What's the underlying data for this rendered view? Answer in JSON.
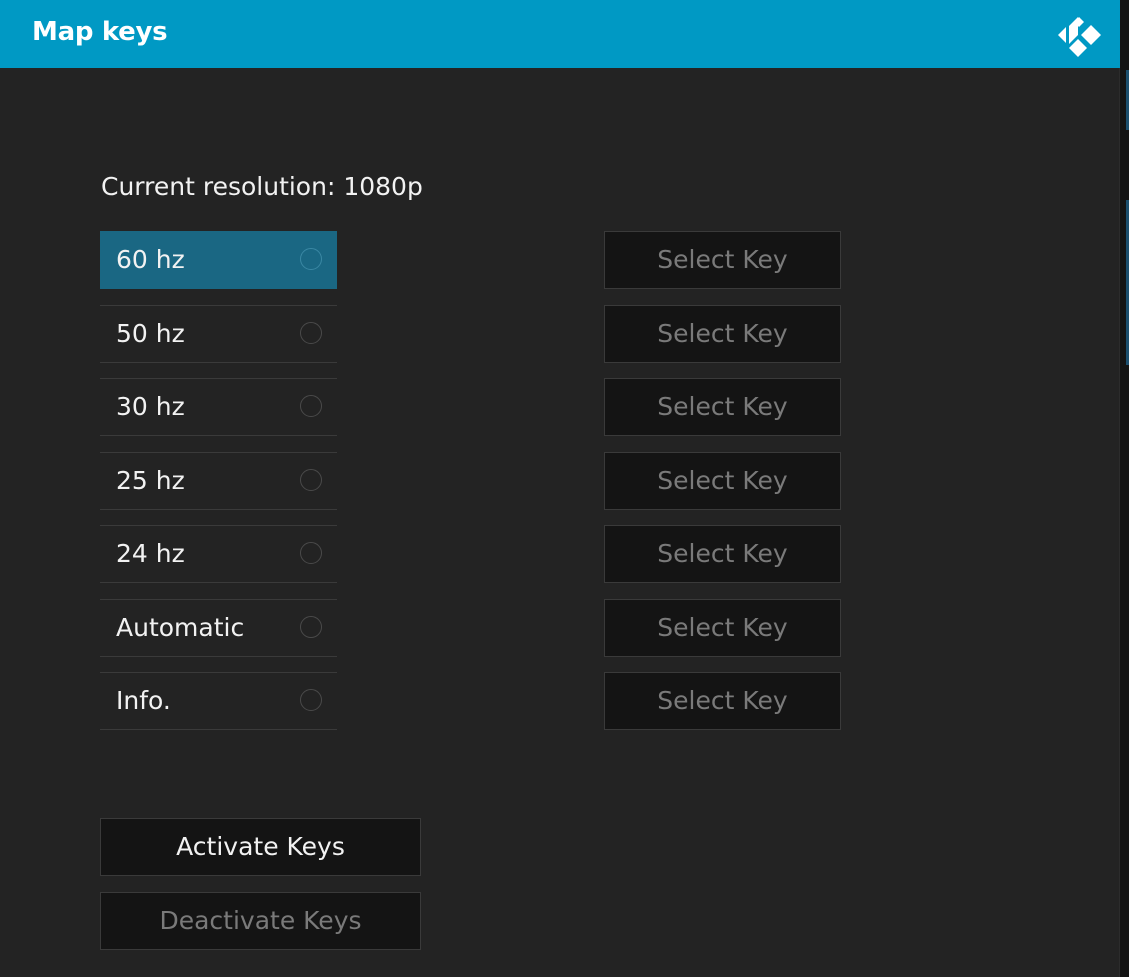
{
  "window": {
    "title": "Map keys",
    "logo_icon": "kodi-logo-icon",
    "accent_color": "#0099c4"
  },
  "resolution": {
    "text": "Current resolution: 1080p"
  },
  "rates": [
    {
      "label": "60 hz",
      "selected": true
    },
    {
      "label": "50 hz",
      "selected": false
    },
    {
      "label": "30 hz",
      "selected": false
    },
    {
      "label": "25 hz",
      "selected": false
    },
    {
      "label": "24 hz",
      "selected": false
    },
    {
      "label": "Automatic",
      "selected": false
    },
    {
      "label": "Info.",
      "selected": false
    }
  ],
  "key_buttons": [
    {
      "label": "Select Key"
    },
    {
      "label": "Select Key"
    },
    {
      "label": "Select Key"
    },
    {
      "label": "Select Key"
    },
    {
      "label": "Select Key"
    },
    {
      "label": "Select Key"
    },
    {
      "label": "Select Key"
    }
  ],
  "actions": {
    "activate_label": "Activate Keys",
    "deactivate_label": "Deactivate Keys"
  },
  "colors": {
    "selected_row": "#1a6783",
    "dialog_bg": "#232323",
    "button_bg": "#141414"
  }
}
